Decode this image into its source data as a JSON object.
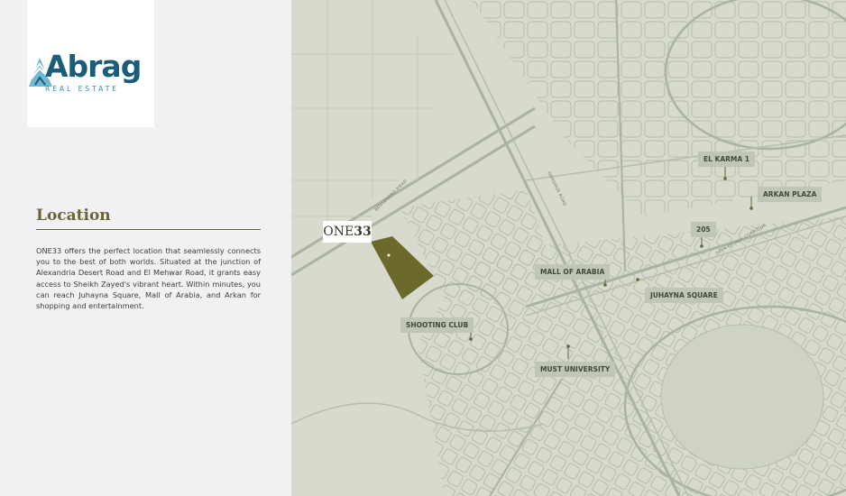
{
  "logo": {
    "name": "Abrag",
    "tagline": "REAL ESTATE",
    "brand_color": "#1b5d79"
  },
  "location": {
    "title": "Location",
    "description": "ONE33 offers the perfect location that seamlessly connects you to the best of both worlds. Situated at the junction of Alexandria Desert Road and El Mehwar Road, it grants easy access to Sheikh Zayed's vibrant heart. Within minutes, you can reach Juhayna Square, Mall of Arabia, and Arkan for shopping and entertainment."
  },
  "project": {
    "prefix": "ONE",
    "number": "33",
    "plot_color": "#6b6a2a"
  },
  "map": {
    "background_color": "#d7dacd",
    "road_color": "#a9b3a1",
    "label_color": "#bfc6b5",
    "landmarks": {
      "el_karma": "EL KARMA 1",
      "arkan": "ARKAN PLAZA",
      "p205": "205",
      "mall_of_arabia": "MALL OF ARABIA",
      "juhayna": "JUHAYNA SQUARE",
      "shooting_club": "SHOOTING CLUB",
      "must": "MUST UNIVERSITY"
    },
    "roads": {
      "boulevard": "BOULEVARD ROAD",
      "dahshur": "DAHSHUR ROAD",
      "corridor": "26TH OF JULY CORRIDOR"
    }
  }
}
